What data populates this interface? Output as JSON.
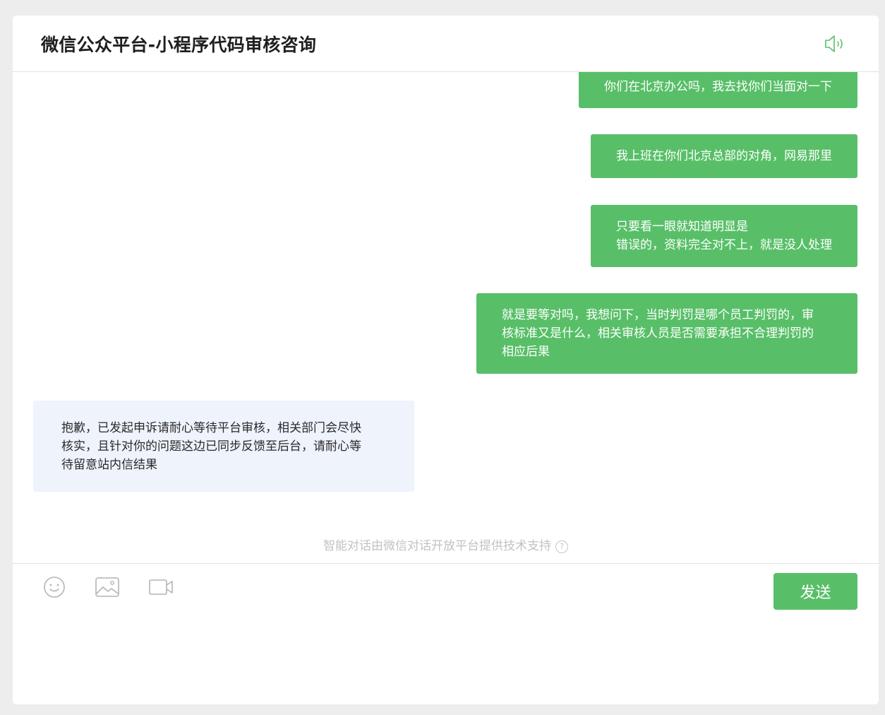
{
  "header": {
    "title": "微信公众平台-小程序代码审核咨询",
    "speaker_icon": "speaker-icon"
  },
  "messages": [
    {
      "direction": "out",
      "text": "你们在北京办公吗，我去找你们当面对一下"
    },
    {
      "direction": "out",
      "text": "我上班在你们北京总部的对角，网易那里"
    },
    {
      "direction": "out",
      "text": "只要看一眼就知道明显是\n错误的，资料完全对不上，就是没人处理"
    },
    {
      "direction": "out",
      "text": "就是要等对吗，我想问下，当时判罚是哪个员工判罚的，审\n核标准又是什么，相关审核人员是否需要承担不合理判罚的\n相应后果"
    },
    {
      "direction": "in",
      "text": "抱歉，已发起申诉请耐心等待平台审核，相关部门会尽快\n核实，且针对你的问题这边已同步反馈至后台，请耐心等\n待留意站内信结果"
    }
  ],
  "footer": {
    "powered_by": "智能对话由微信对话开放平台提供技术支持",
    "help_icon_glyph": "?"
  },
  "toolbar": {
    "icons": [
      "emoji-icon",
      "image-icon",
      "video-icon"
    ],
    "send_label": "发送"
  },
  "colors": {
    "accent": "#58bf68",
    "incoming_bubble": "#eef3fc",
    "background": "#ededed"
  }
}
